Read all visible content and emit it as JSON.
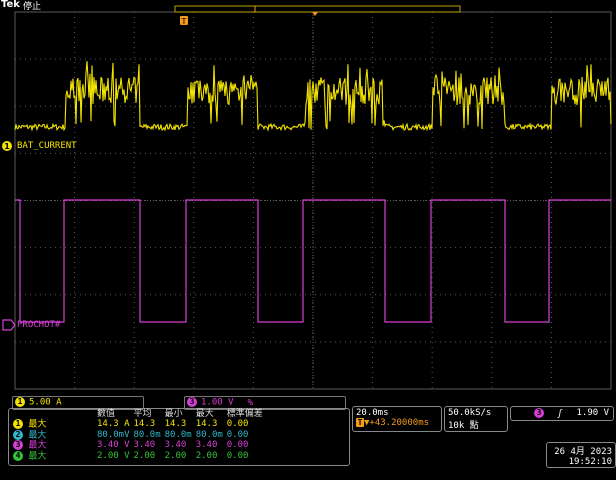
{
  "header": {
    "brand": "Tek",
    "run_state": "停止"
  },
  "colors": {
    "ch1": "#f2e300",
    "ch2": "#2fb6c8",
    "ch3": "#d63fd6",
    "ch4": "#35c23a",
    "trigger": "#f39a1a",
    "grid": "#5a5a5a"
  },
  "channels": {
    "ch1": {
      "number": "1",
      "label": "BAT_CURRENT",
      "scale": "5.00 A"
    },
    "ch3": {
      "number": "3",
      "label": "PROCHOT#",
      "scale": "1.00 V",
      "extra": "%"
    }
  },
  "trigger_marker": "T",
  "measurements": {
    "headers": [
      "數值",
      "平均",
      "最小",
      "最大",
      "標準偏差"
    ],
    "rows": [
      {
        "ch": "1",
        "name": "最大",
        "value": "14.3 A",
        "mean": "14.3",
        "min": "14.3",
        "max": "14.3",
        "std": "0.00"
      },
      {
        "ch": "2",
        "name": "最大",
        "value": "80.0mV",
        "mean": "80.0m",
        "min": "80.0m",
        "max": "80.0m",
        "std": "0.00"
      },
      {
        "ch": "3",
        "name": "最大",
        "value": "3.40 V",
        "mean": "3.40",
        "min": "3.40",
        "max": "3.40",
        "std": "0.00"
      },
      {
        "ch": "4",
        "name": "最大",
        "value": "2.00 V",
        "mean": "2.00",
        "min": "2.00",
        "max": "2.00",
        "std": "0.00"
      }
    ]
  },
  "timebase": {
    "scale": "20.0ms",
    "position": "43.20000ms",
    "position_prefix": "▼+"
  },
  "acquisition": {
    "rate": "50.0kS/s",
    "points": "10k 點"
  },
  "trigger": {
    "channel": "3",
    "slope": "rising-edge-icon",
    "slope_glyph": "ʃ",
    "level": "1.90 V"
  },
  "datetime": {
    "date": "26 4月 2023",
    "time": "19:52:10"
  }
}
